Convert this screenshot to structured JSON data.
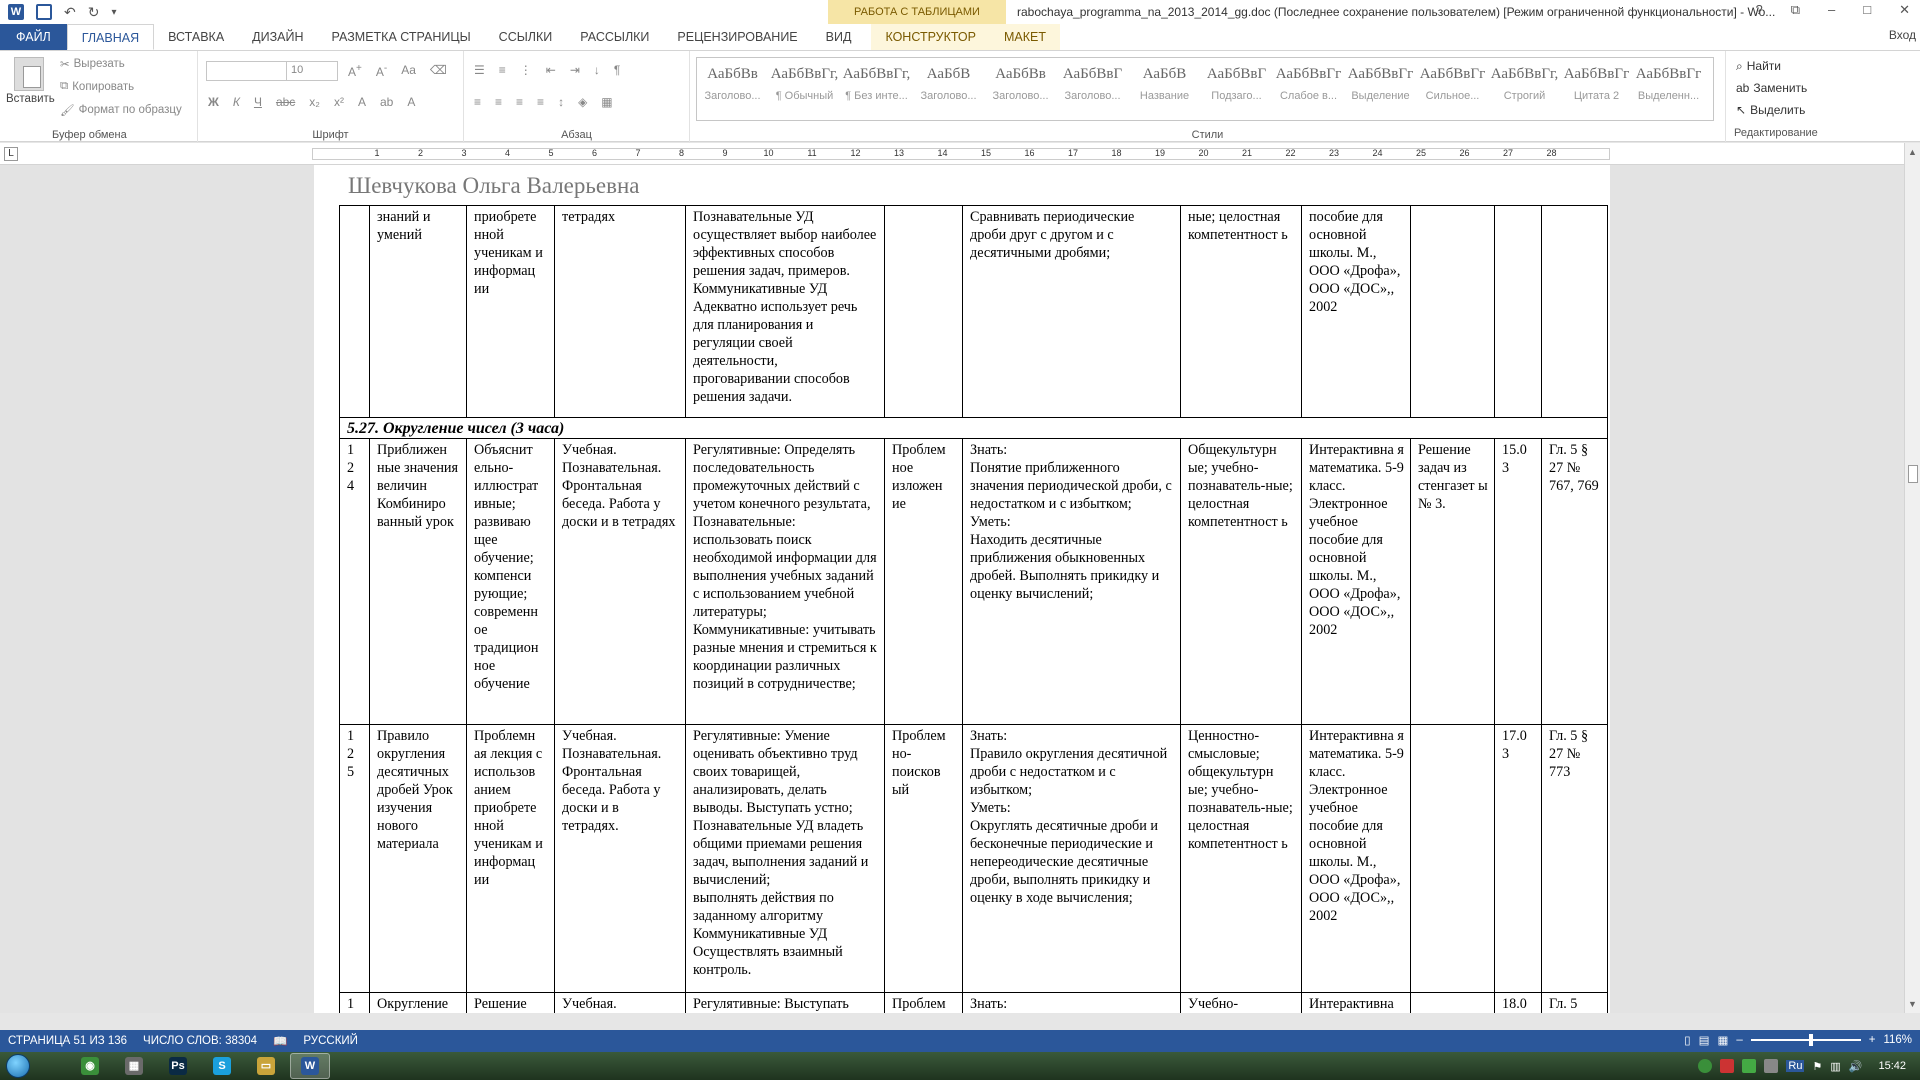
{
  "titlebar": {
    "context_band": "РАБОТА С ТАБЛИЦАМИ",
    "doc_title": "rabochaya_programma_na_2013_2014_gg.doc (Последнее сохранение пользователем) [Режим ограниченной функциональности] - Wo...",
    "help": "?",
    "restore": "⧉",
    "minimize": "–",
    "maximize": "□",
    "close": "✕"
  },
  "tabs": {
    "file": "ФАЙЛ",
    "home": "ГЛАВНАЯ",
    "insert": "ВСТАВКА",
    "design": "ДИЗАЙН",
    "layout": "РАЗМЕТКА СТРАНИЦЫ",
    "refs": "ССЫЛКИ",
    "mailings": "РАССЫЛКИ",
    "review": "РЕЦЕНЗИРОВАНИЕ",
    "view": "ВИД",
    "constructor": "КОНСТРУКТОР",
    "maket": "МАКЕТ",
    "signin": "Вход"
  },
  "ribbon": {
    "paste": "Вставить",
    "cut": "Вырезать",
    "copy": "Копировать",
    "format_painter": "Формат по образцу",
    "clipboard_label": "Буфер обмена",
    "font_name": "",
    "font_size": "10",
    "font_label": "Шрифт",
    "paragraph_label": "Абзац",
    "styles_label": "Стили",
    "editing_label": "Редактирование",
    "find": "Найти",
    "replace": "Заменить",
    "select": "Выделить",
    "styles": [
      {
        "sample": "АаБбВв",
        "name": "Заголово..."
      },
      {
        "sample": "АаБбВвГг,",
        "name": "¶ Обычный"
      },
      {
        "sample": "АаБбВвГг,",
        "name": "¶ Без инте..."
      },
      {
        "sample": "АаБбВ",
        "name": "Заголово..."
      },
      {
        "sample": "АаБбВв",
        "name": "Заголово..."
      },
      {
        "sample": "АаБбВвГ",
        "name": "Заголово..."
      },
      {
        "sample": "АаБбВ",
        "name": "Название"
      },
      {
        "sample": "АаБбВвГ",
        "name": "Подзаго..."
      },
      {
        "sample": "АаБбВвГг",
        "name": "Слабое в..."
      },
      {
        "sample": "АаБбВвГг",
        "name": "Выделение"
      },
      {
        "sample": "АаБбВвГг",
        "name": "Сильное..."
      },
      {
        "sample": "АаБбВвГг,",
        "name": "Строгий"
      },
      {
        "sample": "АаБбВвГг",
        "name": "Цитата 2"
      },
      {
        "sample": "АаБбВвГг",
        "name": "Выделенн..."
      }
    ]
  },
  "ruler": {
    "tab_marker": "L",
    "numbers": [
      "1",
      "2",
      "3",
      "4",
      "5",
      "6",
      "7",
      "8",
      "9",
      "10",
      "11",
      "12",
      "13",
      "14",
      "15",
      "16",
      "17",
      "18",
      "19",
      "20",
      "21",
      "22",
      "23",
      "24",
      "25",
      "26",
      "27",
      "28"
    ]
  },
  "document": {
    "header_text": "Шевчукова Ольга Валерьевна",
    "row_top": {
      "c2": "знаний и умений",
      "c3": "приобрете нной ученикам и информац ии",
      "c4": "тетрадях",
      "c5": "Познавательные УД осуществляет выбор наиболее эффективных способов решения задач, примеров.\nКоммуникативные УД Адекватно использует речь для планирования и регуляции своей деятельности, проговаривании способов решения задачи.",
      "c7": "Сравнивать периодические дроби друг с другом и с десятичными дробями;",
      "c8": "ные; целостная компетентност ь",
      "c9": "пособие для основной школы. М., ООО «Дрофа», ООО «ДОС»,, 2002"
    },
    "section_title": "5.27. Округление чисел (3 часа)",
    "row_124": {
      "num": "1\n2\n4",
      "c2": "Приближен ные значения величин Комбиниро ванный урок",
      "c3": "Объяснит ельно-иллюстрат ивные; развиваю щее обучение; компенси рующие; современн ое традицион ное обучение",
      "c4": "Учебная. Познавательная. Фронтальная беседа. Работа у доски и в тетрадях",
      "c5": "Регулятивные: Определять последовательность промежуточных действий с учетом конечного результата,\nПознавательные: использовать поиск необходимой информации для выполнения учебных заданий с использованием учебной литературы;\nКоммуникативные: учитывать разные мнения и стремиться к координации различных позиций в сотрудничестве;",
      "c6": "Проблем ное изложен ие",
      "c7": "Знать:\nПонятие приближенного значения периодической дроби, с недостатком и с избытком;\nУметь:\nНаходить десятичные приближения обыкновенных дробей. Выполнять прикидку и оценку вычислений;",
      "c8": "Общекультурн ые; учебно-познаватель-ные; целостная компетентност ь",
      "c9": "Интерактивна я математика. 5-9 класс. Электронное учебное пособие для основной школы. М., ООО «Дрофа», ООО «ДОС»,, 2002",
      "c10": "Решение задач из стенгазет ы № 3.",
      "c11": "15.0 3",
      "c12": "Гл. 5 § 27 № 767, 769"
    },
    "row_125": {
      "num": "1\n2\n5",
      "c2": "Правило округления десятичных дробей Урок изучения нового материала",
      "c3": "Проблемн ая лекция с использов анием приобрете нной ученикам и информац ии",
      "c4": "Учебная. Познавательная. Фронтальная беседа. Работа у доски и в тетрадях.",
      "c5": "Регулятивные: Умение оценивать объективно труд своих товарищей, анализировать, делать выводы. Выступать устно;\nПознавательные УД владеть общими приемами решения задач, выполнения заданий и вычислений;\nвыполнять действия по заданному алгоритму\nКоммуникативные УД Осуществлять взаимный контроль.",
      "c6": "Проблем но-поисков ый",
      "c7": "Знать:\nПравило округления десятичной дроби с недостатком и с избытком;\nУметь:\nОкруглять десятичные дроби и бесконечные периодические и непереодические десятичные дроби, выполнять прикидку и оценку в ходе вычисления;",
      "c8": "Ценностно-смысловые; общекультурн ые; учебно-познаватель-ные; целостная компетентност ь",
      "c9": "Интерактивна я математика. 5-9 класс. Электронное учебное пособие для основной школы. М., ООО «Дрофа», ООО «ДОС»,, 2002",
      "c10": "",
      "c11": "17.0 3",
      "c12": "Гл. 5 § 27 № 773"
    },
    "row_last": {
      "num": "1",
      "c2": "Округление",
      "c3": "Решение",
      "c4": "Учебная.",
      "c5": "Регулятивные: Выступать",
      "c6": "Проблем",
      "c7": "Знать:",
      "c8": "Учебно-",
      "c9": "Интерактивна",
      "c10": "",
      "c11": "18.0",
      "c12": "Гл. 5"
    }
  },
  "statusbar": {
    "page": "СТРАНИЦА 51 ИЗ 136",
    "words": "ЧИСЛО СЛОВ: 38304",
    "lang": "РУССКИЙ",
    "zoom_minus": "–",
    "zoom_plus": "+",
    "zoom": "116%"
  },
  "taskbar": {
    "apps": [
      {
        "name": "chrome",
        "label": "◉",
        "color": "#3a8f3a"
      },
      {
        "name": "calculator",
        "label": "▦",
        "color": "#6a6a6a"
      },
      {
        "name": "photoshop",
        "label": "Ps",
        "color": "#0a2a44"
      },
      {
        "name": "skype",
        "label": "S",
        "color": "#1aa0dd"
      },
      {
        "name": "explorer",
        "label": "▭",
        "color": "#c9a43a"
      },
      {
        "name": "word",
        "label": "W",
        "color": "#2b579a"
      }
    ],
    "lang_indicator": "Ru",
    "clock": "15:42"
  }
}
